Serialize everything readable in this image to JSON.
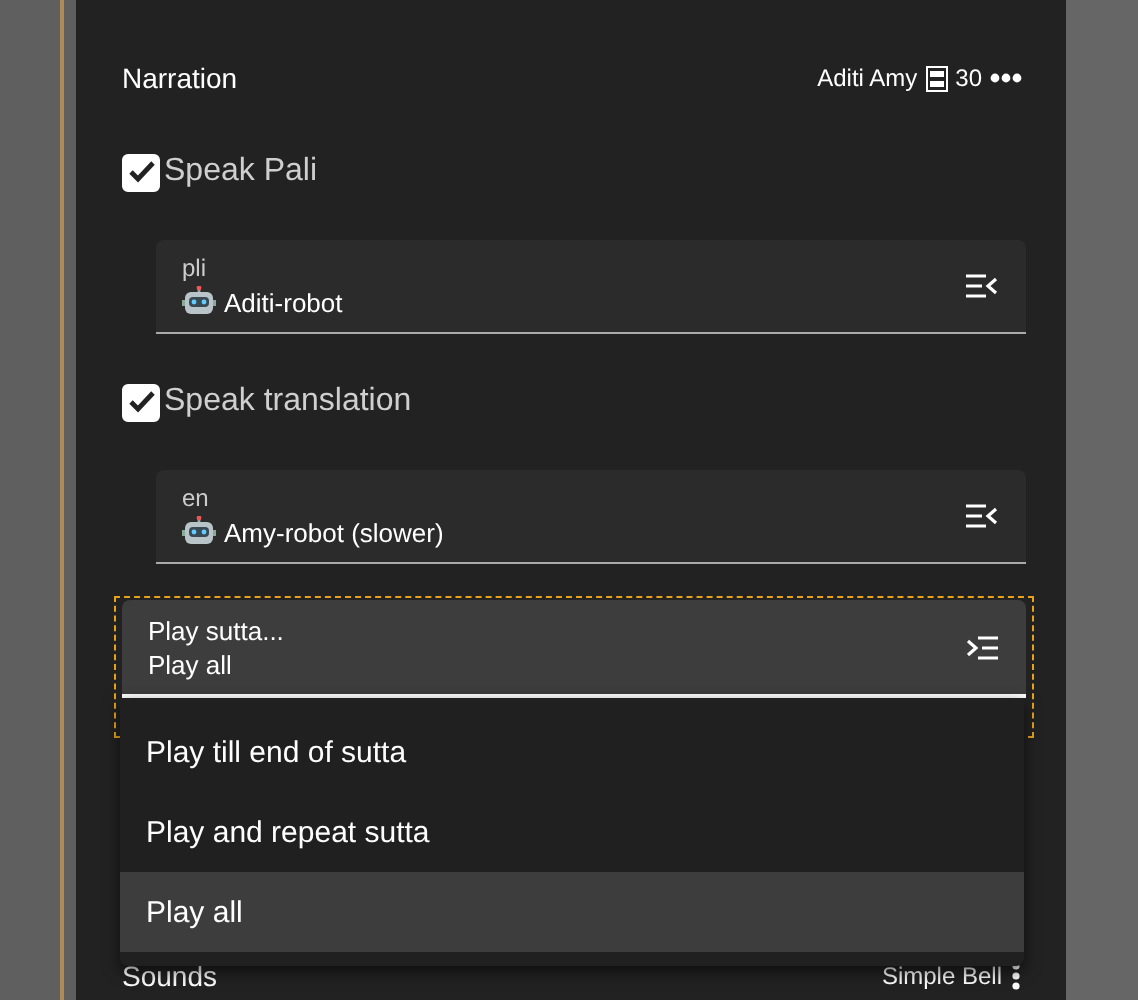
{
  "header": {
    "title": "Narration",
    "summary": "Aditi Amy",
    "count": "30"
  },
  "options": [
    {
      "label": "Speak Pali",
      "checked": true,
      "field": {
        "label": "pli",
        "value": "Aditi-robot"
      }
    },
    {
      "label": "Speak translation",
      "checked": true,
      "field": {
        "label": "en",
        "value": "Amy-robot (slower)"
      }
    }
  ],
  "play": {
    "label": "Play sutta...",
    "value": "Play all",
    "focused": true,
    "expanded": true,
    "items": [
      {
        "label": "Play till end of sutta",
        "selected": false
      },
      {
        "label": "Play and repeat sutta",
        "selected": false
      },
      {
        "label": "Play all",
        "selected": true
      }
    ]
  },
  "sounds": {
    "title": "Sounds",
    "value": "Simple Bell"
  }
}
